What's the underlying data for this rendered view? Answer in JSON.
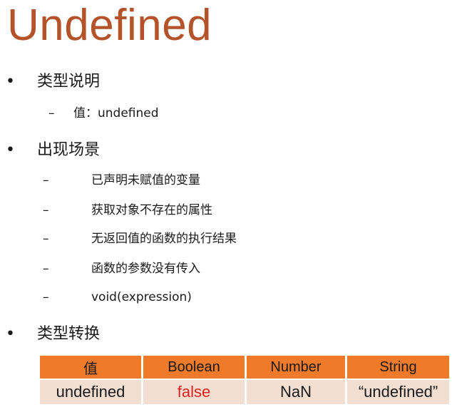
{
  "title": "Undefined",
  "sections": [
    {
      "bullet": "•",
      "heading": "类型说明"
    },
    {
      "bullet": "•",
      "heading": "出现场景"
    },
    {
      "bullet": "•",
      "heading": "类型转换"
    }
  ],
  "type_desc": {
    "dash": "–",
    "value_line": "值：undefined"
  },
  "scenes": [
    {
      "dash": "–",
      "text": "已声明未赋值的变量"
    },
    {
      "dash": "–",
      "text": "获取对象不存在的属性"
    },
    {
      "dash": "–",
      "text": "无返回值的函数的执行结果"
    },
    {
      "dash": "–",
      "text": "函数的参数没有传入"
    },
    {
      "dash": "–",
      "text": "void(expression)"
    }
  ],
  "conversion_table": {
    "headers": [
      "值",
      "Boolean",
      "Number",
      "String"
    ],
    "row": [
      "undefined",
      "false",
      "NaN",
      "“undefined”"
    ]
  },
  "colors": {
    "title": "#b4532a",
    "header_bg": "#ee7a2a",
    "row_bg": "#f3dfd2",
    "false_text": "#e02020"
  }
}
